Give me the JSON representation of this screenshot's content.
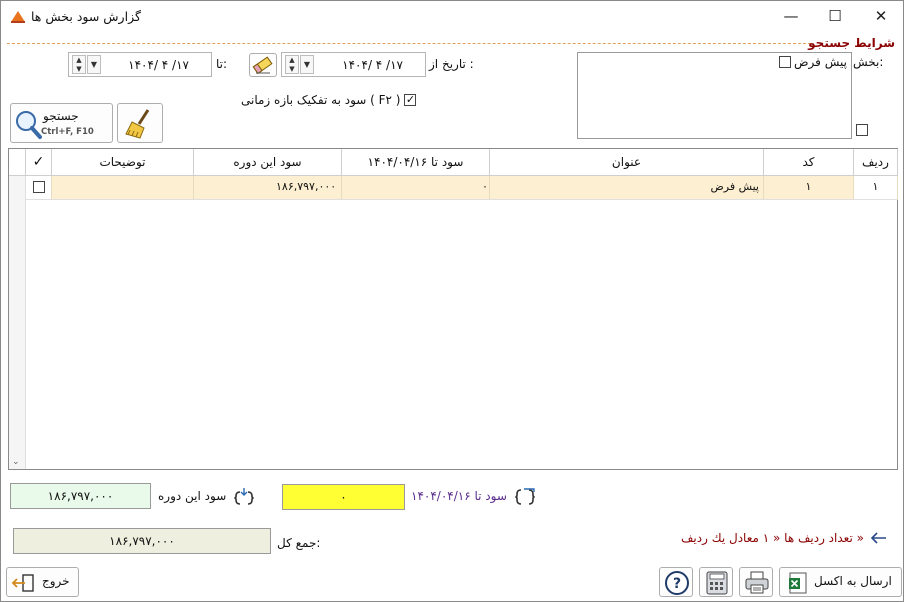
{
  "window": {
    "title": "گزارش سود بخش ها",
    "minimize": "—",
    "maximize": "☐",
    "close": "✕"
  },
  "search_group": {
    "title": "شرایط جستجو",
    "section_label": "بخش:",
    "section_items": [
      {
        "label": "پیش فرض",
        "checked": false
      }
    ],
    "date_from_label": "تاریخ از :",
    "date_from": "۱۴۰۴/ ۴ /۱۷",
    "date_to_label": "تا:",
    "date_to": "۱۴۰۴/ ۴ /۱۷",
    "split_period_label": "سود به تفکیک بازه زمانی ( F۲ )",
    "split_period_checked": true,
    "search_button": "جستجو",
    "search_shortcut": "Ctrl+F, F10"
  },
  "grid": {
    "columns": [
      "ردیف",
      "کد",
      "عنوان",
      "سود تا ۱۴۰۴/۰۴/۱۶",
      "سود این دوره",
      "توضیحات",
      "✓"
    ],
    "rows": [
      {
        "row": "۱",
        "code": "۱",
        "title": "پیش فرض",
        "profit_until": "۰",
        "profit_period": "۱۸۶,۷۹۷,۰۰۰",
        "notes": "",
        "checked": false
      }
    ]
  },
  "summary": {
    "profit_until_label": "سود تا ۱۴۰۴/۰۴/۱۶",
    "profit_until_value": "۰",
    "profit_period_label": "سود این دوره",
    "profit_period_value": "۱۸۶,۷۹۷,۰۰۰",
    "total_label": "جمع کل:",
    "total_value": "۱۸۶,۷۹۷,۰۰۰",
    "row_count_text": "تعداد ردیف ها « ۱ معادل یك  ردیف »"
  },
  "footer": {
    "export_excel": "ارسال به اکسل",
    "exit": "خروج"
  },
  "colors": {
    "accent_red": "#8b0000",
    "row_highlight": "#fdf0d2",
    "yellow_box": "#ffff33",
    "green_box": "#eafaea",
    "gray_box": "#efefdf",
    "purple_text": "#5a2d8c"
  }
}
